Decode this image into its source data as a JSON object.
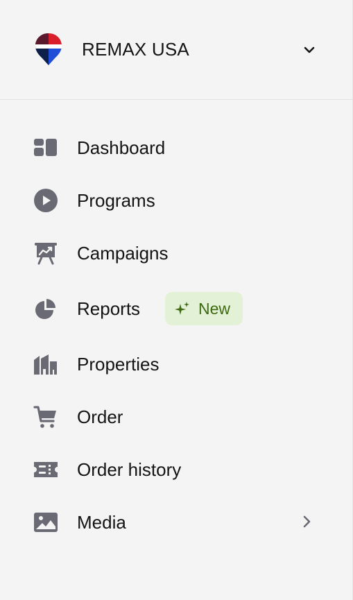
{
  "org": {
    "name": "REMAX USA",
    "logo_icon": "remax-balloon-logo",
    "switch_icon": "chevron-down-icon"
  },
  "nav": {
    "items": [
      {
        "label": "Dashboard",
        "icon": "dashboard-icon"
      },
      {
        "label": "Programs",
        "icon": "play-circle-icon"
      },
      {
        "label": "Campaigns",
        "icon": "presentation-chart-icon"
      },
      {
        "label": "Reports",
        "icon": "pie-chart-icon",
        "badge": "New"
      },
      {
        "label": "Properties",
        "icon": "buildings-icon"
      },
      {
        "label": "Order",
        "icon": "cart-icon"
      },
      {
        "label": "Order history",
        "icon": "ticket-list-icon"
      },
      {
        "label": "Media",
        "icon": "image-icon",
        "expand_icon": "chevron-right-icon"
      }
    ]
  },
  "colors": {
    "background": "#f4f4f4",
    "text": "#141414",
    "icon": "#6a6a74",
    "badge_bg": "#e3f1d6",
    "badge_text": "#3d6a12",
    "logo_red": "#d81f2a",
    "logo_blue": "#1f4fd8",
    "logo_navy": "#0d1b3d"
  }
}
